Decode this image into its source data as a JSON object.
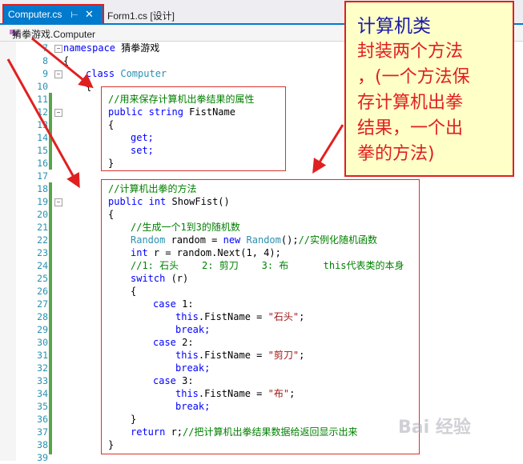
{
  "tabs": {
    "active_label": "Computer.cs",
    "pin_glyph": "⊢",
    "close_glyph": "✕",
    "inactive_label": "Form1.cs [设计]"
  },
  "navbar": {
    "path": "猜拳游戏.Computer"
  },
  "note": {
    "title": "计算机类",
    "line1": "封装两个方法",
    "line2": "，(一个方法保",
    "line3": "存计算机出拳",
    "line4": "结果，一个出",
    "line5": "拳的方法)"
  },
  "watermark": {
    "text": "Bai 经验"
  },
  "code": {
    "line_numbers": [
      "7",
      "8",
      "9",
      "10",
      "11",
      "12",
      "13",
      "14",
      "15",
      "16",
      "17",
      "18",
      "19",
      "20",
      "21",
      "22",
      "23",
      "24",
      "25",
      "26",
      "27",
      "28",
      "29",
      "30",
      "31",
      "32",
      "33",
      "34",
      "35",
      "36",
      "37",
      "38",
      "39"
    ],
    "l7_kw": "namespace",
    "l7_rest": " 猜拳游戏",
    "l8": "{",
    "l9_kw": "class",
    "l9_ty": "Computer",
    "l10": "{",
    "l11": "//用来保存计算机出拳结果的属性",
    "l12_kw1": "public",
    "l12_kw2": "string",
    "l12_rest": " FistName",
    "l13": "{",
    "l14": "get;",
    "l15": "set;",
    "l16": "}",
    "l18": "//计算机出拳的方法",
    "l19_kw1": "public",
    "l19_kw2": "int",
    "l19_rest": " ShowFist()",
    "l20": "{",
    "l21": "//生成一个1到3的随机数",
    "l22_ty1": "Random",
    "l22_mid": " random = ",
    "l22_kw": "new",
    "l22_ty2": "Random",
    "l22_tail": "();",
    "l22_cm": "//实例化随机函数",
    "l23_kw": "int",
    "l23_rest": " r = random.Next(1, 4);",
    "l24": "//1: 石头    2: 剪刀    3: 布      this代表类的本身",
    "l25_kw": "switch",
    "l25_rest": " (r)",
    "l26": "{",
    "l27_kw": "case",
    "l27_rest": " 1:",
    "l28_kw": "this",
    "l28_rest": ".FistName = ",
    "l28_st": "\"石头\"",
    "l28_end": ";",
    "l29": "break;",
    "l30_kw": "case",
    "l30_rest": " 2:",
    "l31_kw": "this",
    "l31_rest": ".FistName = ",
    "l31_st": "\"剪刀\"",
    "l31_end": ";",
    "l32": "break;",
    "l33_kw": "case",
    "l33_rest": " 3:",
    "l34_kw": "this",
    "l34_rest": ".FistName = ",
    "l34_st": "\"布\"",
    "l34_end": ";",
    "l35": "break;",
    "l36": "}",
    "l37_kw": "return",
    "l37_rest": " r;",
    "l37_cm": "//把计算机出拳结果数据给返回显示出来",
    "l38": "}"
  },
  "colors": {
    "accent": "#007acc",
    "annotation_red": "#e02020",
    "keyword": "#0000ff",
    "type": "#2b91af",
    "comment": "#008000",
    "string": "#a31515",
    "note_bg": "#ffffc8"
  }
}
